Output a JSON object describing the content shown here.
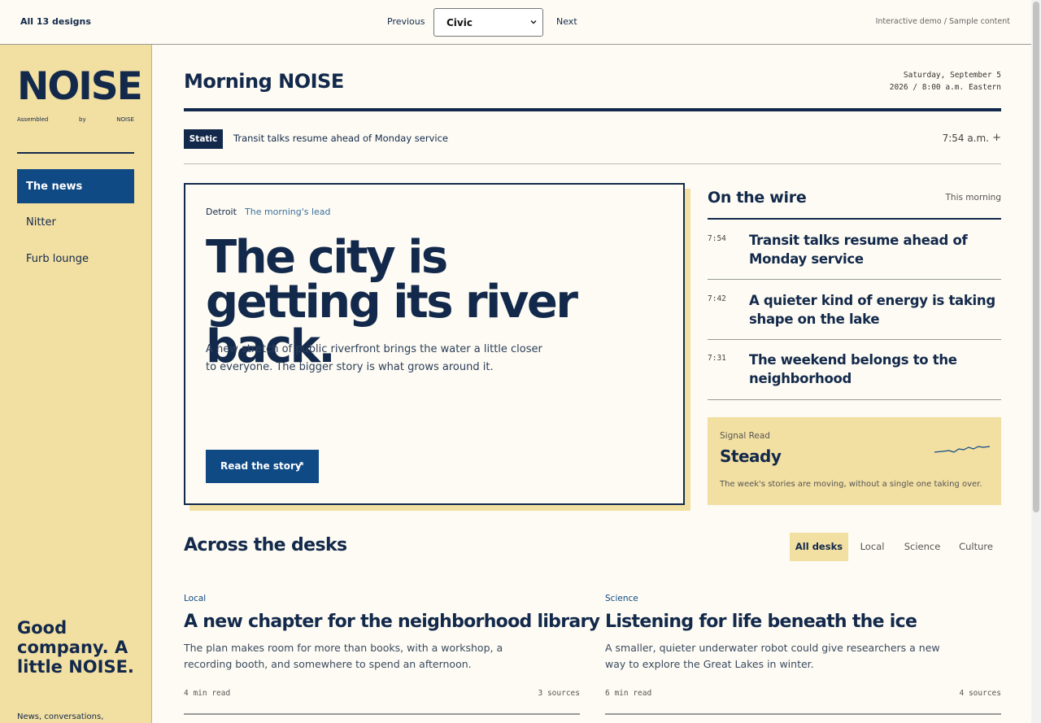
{
  "topbar": {
    "all_designs": "All 13 designs",
    "previous": "Previous",
    "design_select": "Civic",
    "next": "Next",
    "demo_note": "Interactive demo / Sample content"
  },
  "sidebar": {
    "brand": "NOISE",
    "assembled": [
      "Assembled",
      "by",
      "NOISE"
    ],
    "nav": [
      {
        "label": "The news",
        "active": true
      },
      {
        "label": "Nitter",
        "active": false
      },
      {
        "label": "Furb lounge",
        "active": false
      }
    ],
    "tagline": "Good company. A little NOISE.",
    "tagline_sub": "News, conversations,"
  },
  "masthead": {
    "title": "Morning NOISE",
    "date_line1": "Saturday, September 5",
    "date_line2": "2026 / 8:00 a.m. Eastern"
  },
  "ticker": {
    "badge": "Static",
    "text": "Transit talks resume ahead of Monday service",
    "time": "7:54 a.m.",
    "plus": "+"
  },
  "lead": {
    "location": "Detroit",
    "kicker": "The morning's lead",
    "headline": "The city is getting its river back.",
    "dek": "A new stretch of public riverfront brings the water a little closer to everyone. The bigger story is what grows around it.",
    "button": "Read the story",
    "button_icon": "↗"
  },
  "wire": {
    "title": "On the wire",
    "note": "This morning",
    "items": [
      {
        "time": "7:54",
        "headline": "Transit talks resume ahead of Monday service"
      },
      {
        "time": "7:42",
        "headline": "A quieter kind of energy is taking shape on the lake"
      },
      {
        "time": "7:31",
        "headline": "The weekend belongs to the neighborhood"
      }
    ]
  },
  "signal": {
    "label": "Signal Read",
    "value": "Steady",
    "description": "The week's stories are moving, without a single one taking over.",
    "sparkline_color": "#0f4a85"
  },
  "desks": {
    "title": "Across the desks",
    "tabs": [
      "All desks",
      "Local",
      "Science",
      "Culture"
    ],
    "active_tab": "All desks",
    "stories": [
      {
        "desk": "Local",
        "headline": "A new chapter for the neighborhood library",
        "dek": "The plan makes room for more than books, with a workshop, a recording booth, and somewhere to spend an afternoon.",
        "read_time": "4 min read",
        "sources": "3 sources"
      },
      {
        "desk": "Science",
        "headline": "Listening for life beneath the ice",
        "dek": "A smaller, quieter underwater robot could give researchers a new way to explore the Great Lakes in winter.",
        "read_time": "6 min read",
        "sources": "4 sources"
      }
    ]
  },
  "colors": {
    "navy": "#13294b",
    "accent_blue": "#0f4a85",
    "sand": "#f2dfa2",
    "paper": "#fdfbf3"
  }
}
